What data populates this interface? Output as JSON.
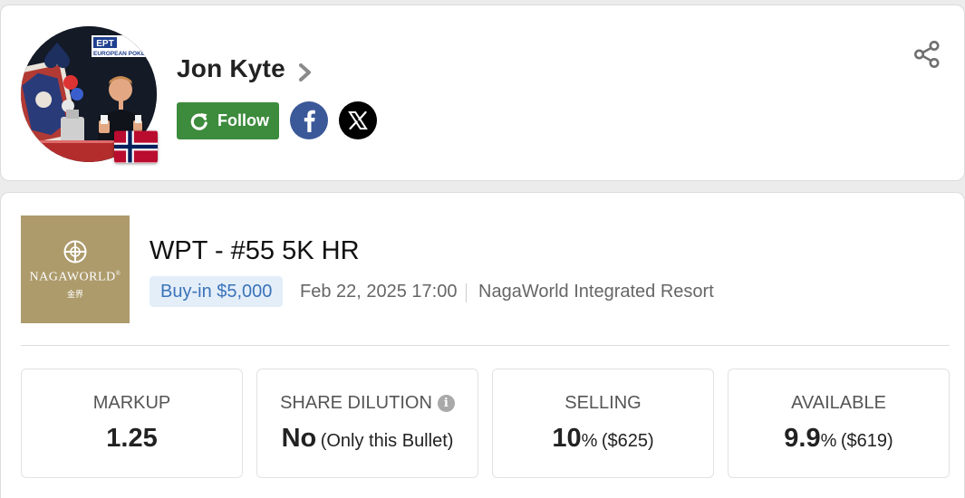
{
  "player": {
    "name": "Jon Kyte",
    "follow_label": "Follow",
    "avatar_banner_text": "EPT",
    "avatar_banner_sub": "EUROPEAN POKER T"
  },
  "event": {
    "title": "WPT - #55 5K HR",
    "buyin": "Buy-in $5,000",
    "date": "Feb 22, 2025 17:00",
    "venue": "NagaWorld Integrated Resort",
    "venue_logo": {
      "brand": "NAGAWORLD",
      "reg": "®",
      "sub": "金界"
    }
  },
  "stats": {
    "markup": {
      "label": "MARKUP",
      "value": "1.25"
    },
    "dilution": {
      "label": "SHARE DILUTION",
      "value": "No",
      "note": "(Only this Bullet)"
    },
    "selling": {
      "label": "SELLING",
      "value": "10",
      "unit": "%",
      "amount": "($625)"
    },
    "available": {
      "label": "AVAILABLE",
      "value": "9.9",
      "unit": "%",
      "amount": "($619)"
    }
  },
  "colors": {
    "follow": "#3d8b3d",
    "facebook": "#3b5998",
    "buyin_text": "#3a73b8",
    "available": "#3fa53a",
    "venue_logo_bg": "#ad9b6c"
  },
  "icons": [
    "chevron-right-icon",
    "refresh-icon",
    "facebook-icon",
    "x-icon",
    "share-icon",
    "info-icon",
    "norway-flag-icon"
  ]
}
